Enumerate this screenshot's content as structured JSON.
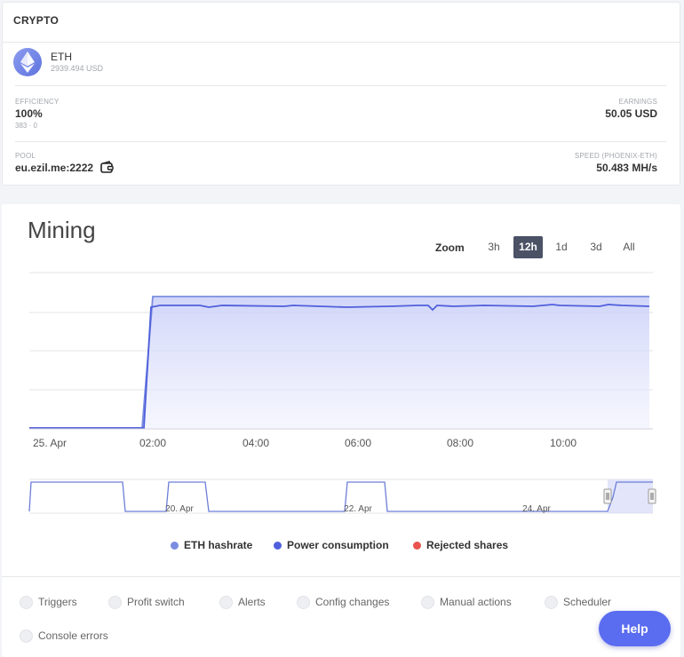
{
  "crypto_card": {
    "title": "CRYPTO",
    "coin": {
      "name": "ETH",
      "price": "2939.494 USD"
    },
    "efficiency": {
      "label": "EFFICIENCY",
      "value": "100%",
      "sub": "383 · 0"
    },
    "earnings": {
      "label": "EARNINGS",
      "value": "50.05 USD"
    },
    "pool": {
      "label": "POOL",
      "value": "eu.ezil.me:2222"
    },
    "speed": {
      "label": "SPEED (PHOENIX-ETH)",
      "value": "50.483 MH/s"
    }
  },
  "mining": {
    "title": "Mining",
    "zoom_label": "Zoom",
    "zoom_options": [
      "3h",
      "12h",
      "1d",
      "3d",
      "All"
    ],
    "zoom_selected": "12h"
  },
  "chart_data": {
    "type": "area",
    "x_ticks": [
      "25. Apr",
      "02:00",
      "04:00",
      "06:00",
      "08:00",
      "10:00"
    ],
    "navigator_ticks": [
      "20. Apr",
      "22. Apr",
      "24. Apr"
    ],
    "series": [
      {
        "name": "ETH hashrate",
        "color": "#7b8de0"
      },
      {
        "name": "Power consumption",
        "color": "#4f5fdc"
      },
      {
        "name": "Rejected shares",
        "color": "#e9534f"
      }
    ]
  },
  "filters": [
    "Triggers",
    "Profit switch",
    "Alerts",
    "Config changes",
    "Manual actions",
    "Scheduler",
    "Console errors"
  ],
  "help_label": "Help"
}
